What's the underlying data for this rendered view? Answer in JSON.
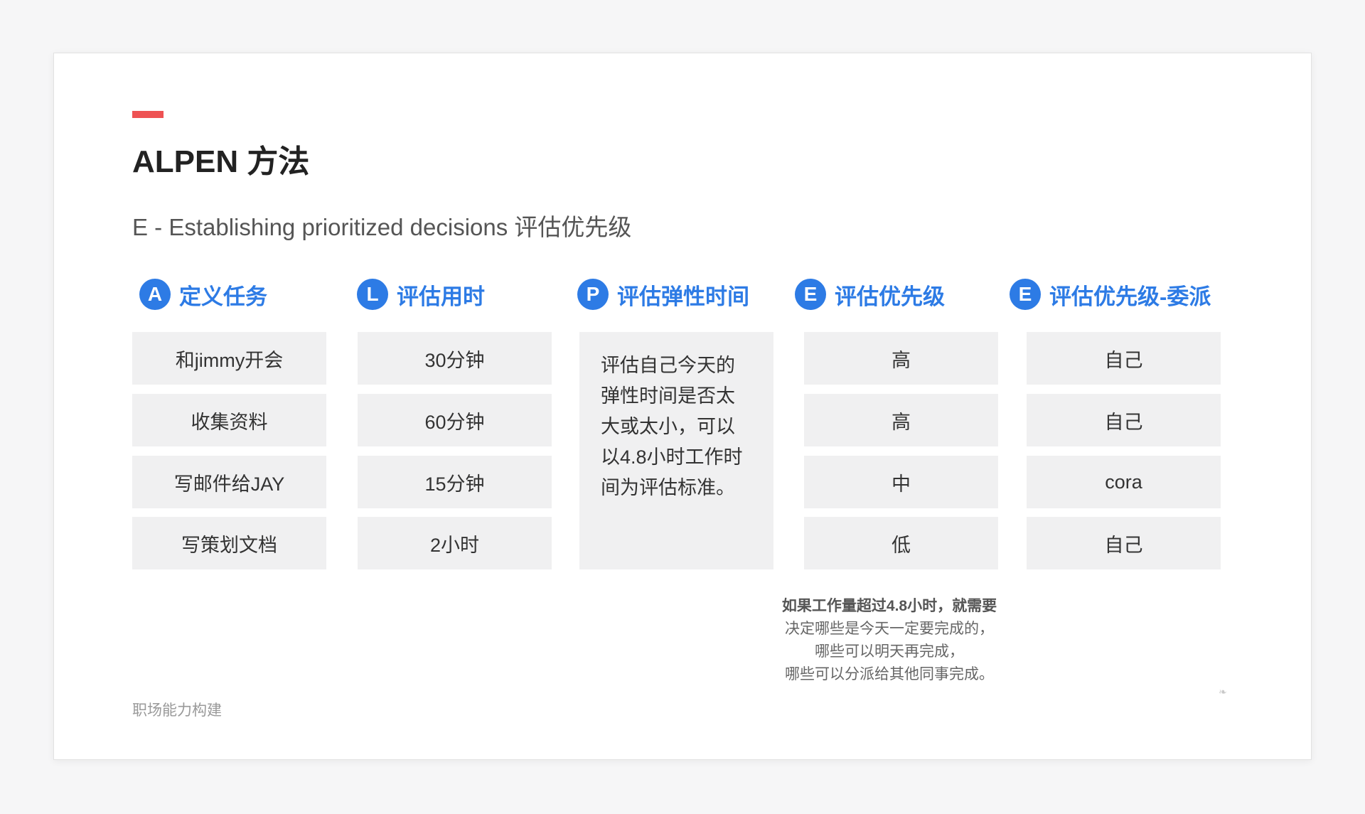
{
  "slide": {
    "title": "ALPEN 方法",
    "subtitle": "E - Establishing prioritized decisions 评估优先级",
    "footer": "职场能力构建",
    "accent_color": "#ee5253",
    "brand_color": "#2d7be5"
  },
  "columns": [
    {
      "badge": "A",
      "label": "定义任务",
      "cells": [
        "和jimmy开会",
        "收集资料",
        "写邮件给JAY",
        "写策划文档"
      ]
    },
    {
      "badge": "L",
      "label": "评估用时",
      "cells": [
        "30分钟",
        "60分钟",
        "15分钟",
        "2小时"
      ]
    },
    {
      "badge": "P",
      "label": "评估弹性时间",
      "text_lines": [
        "评估自己今天的",
        "弹性时间是否太",
        "大或太小，可以",
        "以4.8小时工作时",
        "间为评估标准。"
      ]
    },
    {
      "badge": "E",
      "label": "评估优先级",
      "cells": [
        "高",
        "高",
        "中",
        "低"
      ]
    },
    {
      "badge": "E",
      "label": "评估优先级-委派",
      "cells": [
        "自己",
        "自己",
        "cora",
        "自己"
      ]
    }
  ],
  "note": {
    "line1": "如果工作量超过4.8小时，就需要",
    "line2": "决定哪些是今天一定要完成的，",
    "line3": "哪些可以明天再完成，",
    "line4": "哪些可以分派给其他同事完成。"
  }
}
